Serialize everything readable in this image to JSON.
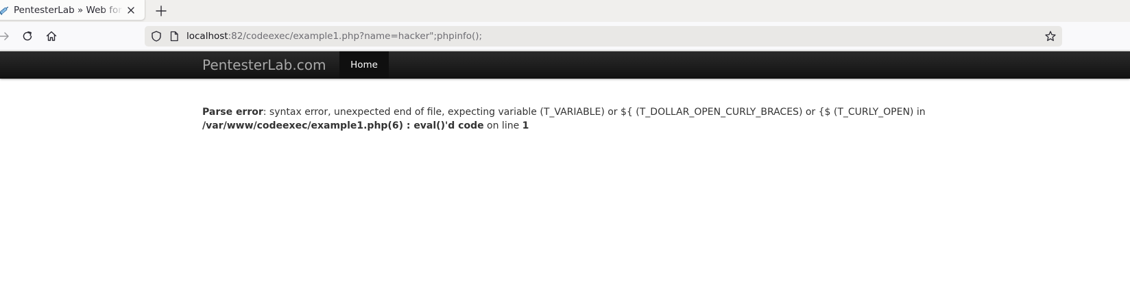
{
  "browser": {
    "tab": {
      "title": "PentesterLab » Web for Pentester",
      "favicon": "syringe-icon"
    },
    "url": {
      "host": "localhost",
      "path": ":82/codeexec/example1.php?name=hacker\";phpinfo();"
    }
  },
  "site": {
    "brand": "PentesterLab.com",
    "nav": {
      "home": "Home"
    }
  },
  "error": {
    "label": "Parse error",
    "message": ": syntax error, unexpected end of file, expecting variable (T_VARIABLE) or ${ (T_DOLLAR_OPEN_CURLY_BRACES) or {$ (T_CURLY_OPEN) in ",
    "file": "/var/www/codeexec/example1.php(6) : eval()'d code",
    "line_prefix": " on line ",
    "line": "1"
  },
  "colors": {
    "header_bg": "#1a1a1a",
    "brand_text": "#a8a8a8",
    "active_nav_bg": "#0f0f0f"
  }
}
